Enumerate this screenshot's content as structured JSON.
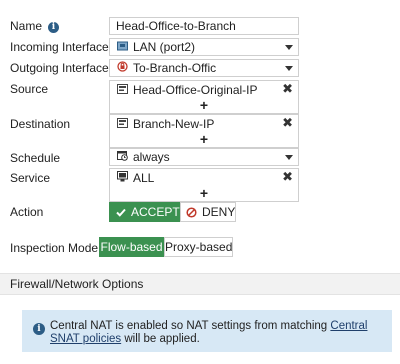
{
  "form": {
    "name": {
      "label": "Name",
      "value": "Head-Office-to-Branch"
    },
    "incoming_interface": {
      "label": "Incoming Interface",
      "value": "LAN (port2)",
      "icon": "network-port-icon"
    },
    "outgoing_interface": {
      "label": "Outgoing Interface",
      "value": "To-Branch-Offic",
      "icon": "vpn-tunnel-icon"
    },
    "source": {
      "label": "Source",
      "entry": "Head-Office-Original-IP",
      "entry_icon": "address-icon",
      "remove": "✖",
      "add": "+"
    },
    "destination": {
      "label": "Destination",
      "entry": "Branch-New-IP",
      "entry_icon": "address-icon",
      "remove": "✖",
      "add": "+"
    },
    "schedule": {
      "label": "Schedule",
      "value": "always",
      "icon": "schedule-icon"
    },
    "service": {
      "label": "Service",
      "entry": "ALL",
      "entry_icon": "service-icon",
      "remove": "✖",
      "add": "+"
    },
    "action": {
      "label": "Action",
      "accept_label": "ACCEPT",
      "deny_label": "DENY",
      "selected": "ACCEPT"
    },
    "inspection_mode": {
      "label": "Inspection Mode",
      "flow_label": "Flow-based",
      "proxy_label": "Proxy-based",
      "selected": "Flow-based"
    }
  },
  "section": {
    "title": "Firewall/Network Options"
  },
  "notice": {
    "text_before": "Central NAT is enabled so NAT settings from matching ",
    "link_text": "Central SNAT policies",
    "text_after": " will be applied."
  },
  "colors": {
    "accent_green": "#3b9150",
    "info_blue": "#2c5d86",
    "notice_bg": "#d7e8f5",
    "deny_red": "#c0392b"
  }
}
